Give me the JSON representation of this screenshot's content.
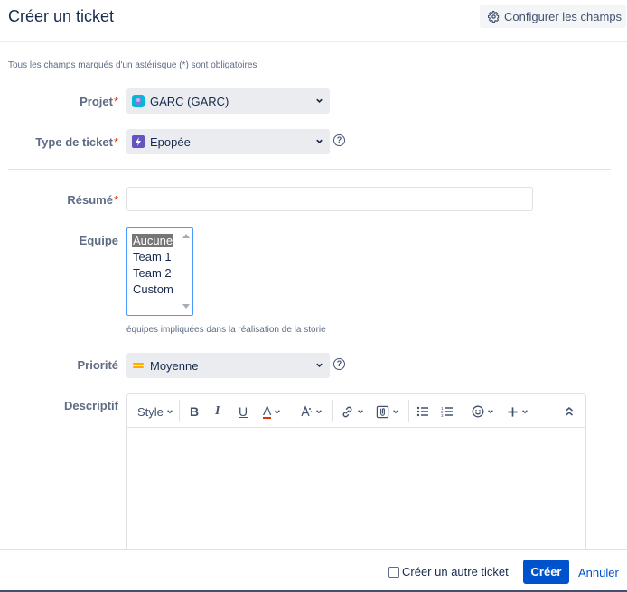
{
  "dialog": {
    "title": "Créer un ticket",
    "configure_label": "Configurer les champs",
    "required_note": "Tous les champs marqués d'un astérisque (*) sont obligatoires"
  },
  "fields": {
    "project": {
      "label": "Projet",
      "required_mark": "*",
      "value": "GARC (GARC)"
    },
    "issue_type": {
      "label": "Type de ticket",
      "required_mark": "*",
      "value": "Epopée"
    },
    "summary": {
      "label": "Résumé",
      "required_mark": "*",
      "value": ""
    },
    "team": {
      "label": "Equipe",
      "options": [
        "Aucune",
        "Team 1",
        "Team 2",
        "Custom"
      ],
      "selected": "Aucune",
      "hint": "équipes impliquées dans la réalisation de la storie"
    },
    "priority": {
      "label": "Priorité",
      "value": "Moyenne"
    },
    "description": {
      "label": "Descriptif",
      "toolbar": {
        "style_label": "Style",
        "bold": "B",
        "italic": "I",
        "underline": "U",
        "text_color": "A",
        "icons": [
          "bold-icon",
          "italic-icon",
          "underline-icon",
          "text-color-icon",
          "text-effects-icon",
          "link-icon",
          "attachment-icon",
          "bullet-list-icon",
          "numbered-list-icon",
          "emoji-icon",
          "insert-more-icon",
          "collapse-icon"
        ]
      }
    }
  },
  "footer": {
    "create_another_label": "Créer un autre ticket",
    "create_another_checked": false,
    "create_label": "Créer",
    "cancel_label": "Annuler"
  },
  "colors": {
    "primary": "#0052cc",
    "required": "#de350b",
    "project_icon": "#00b8d9",
    "epic_icon": "#6554c0",
    "priority_medium": "#ffab00",
    "text_color_underline": "#de350b"
  }
}
